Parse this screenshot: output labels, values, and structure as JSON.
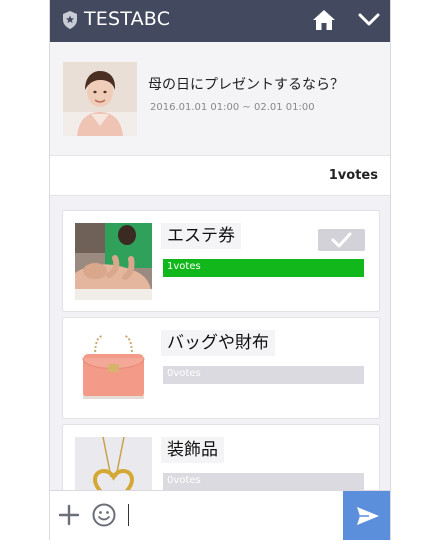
{
  "app": {
    "title": "TESTABC",
    "accent": "#434a5f"
  },
  "poll": {
    "title": "母の日にプレゼントするなら？",
    "date_range": "2016.01.01 01:00 ~ 02.01 01:00",
    "total_votes": "1votes"
  },
  "options": [
    {
      "label": "エステ券",
      "votes": "1votes",
      "vote_fraction": 1.0,
      "selected": true,
      "image": "massage-photo"
    },
    {
      "label": "バッグや財布",
      "votes": "0votes",
      "vote_fraction": 0.0,
      "selected": false,
      "image": "pink-handbag-photo"
    },
    {
      "label": "装飾品",
      "votes": "0votes",
      "vote_fraction": 0.0,
      "selected": false,
      "image": "heart-necklace-photo"
    }
  ],
  "icons": {
    "shield": "shield-icon",
    "home": "home-icon",
    "chevron": "chevron-down-icon",
    "check": "check-icon",
    "plus": "plus-icon",
    "emoji": "emoji-icon",
    "send": "send-icon"
  },
  "colors": {
    "vote_bar_fill": "#12b81b",
    "vote_bar_empty": "#dadae0",
    "send_button": "#5b8fdc"
  }
}
